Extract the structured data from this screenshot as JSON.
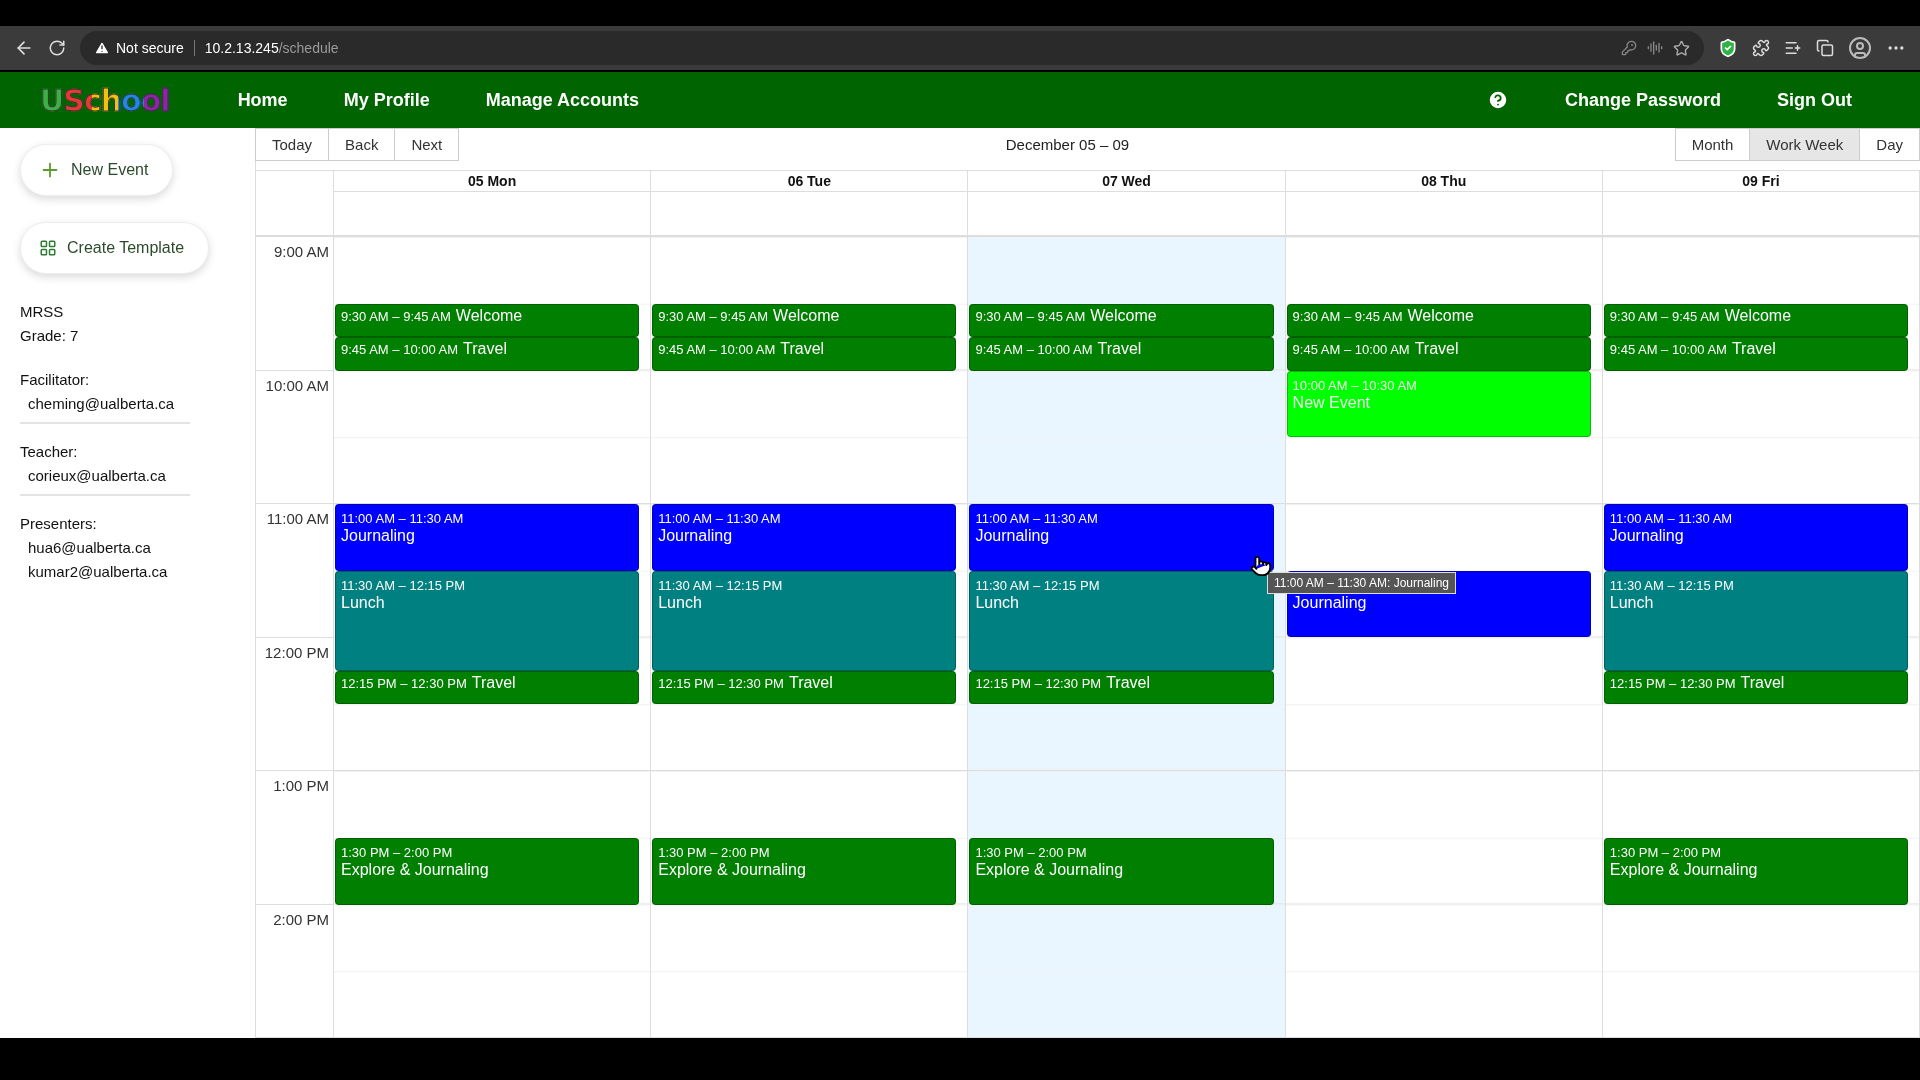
{
  "browser": {
    "security": "Not secure",
    "url_host": "10.2.13.245",
    "url_path": "/schedule"
  },
  "nav": {
    "logo": "USchool",
    "links": [
      "Home",
      "My Profile",
      "Manage Accounts"
    ],
    "right_links": [
      "Change Password",
      "Sign Out"
    ]
  },
  "sidebar": {
    "buttons": [
      "New Event",
      "Create Template"
    ],
    "school": "MRSS",
    "grade": "Grade: 7",
    "contacts": [
      {
        "role": "Facilitator:",
        "emails": [
          "cheming@ualberta.ca"
        ]
      },
      {
        "role": "Teacher:",
        "emails": [
          "corieux@ualberta.ca"
        ]
      },
      {
        "role": "Presenters:",
        "emails": [
          "hua6@ualberta.ca",
          "kumar2@ualberta.ca"
        ]
      }
    ]
  },
  "toolbar": {
    "nav_buttons": [
      "Today",
      "Back",
      "Next"
    ],
    "range": "December 05 – 09",
    "views": [
      {
        "label": "Month",
        "selected": false
      },
      {
        "label": "Work Week",
        "selected": true
      },
      {
        "label": "Day",
        "selected": false
      }
    ]
  },
  "time_labels": [
    "9:00 AM",
    "10:00 AM",
    "11:00 AM",
    "12:00 PM",
    "1:00 PM",
    "2:00 PM"
  ],
  "days": [
    {
      "label": "05 Mon",
      "today": false,
      "events": [
        {
          "time": "9:30 AM – 9:45 AM",
          "title": "Welcome",
          "color": "#007f00"
        },
        {
          "time": "9:45 AM – 10:00 AM",
          "title": "Travel",
          "color": "#007f00"
        },
        {
          "time": "11:00 AM – 11:30 AM",
          "title": "Journaling",
          "color": "#0000ff"
        },
        {
          "time": "11:30 AM – 12:15 PM",
          "title": "Lunch",
          "color": "#008080"
        },
        {
          "time": "12:15 PM – 12:30 PM",
          "title": "Travel",
          "color": "#007f00"
        },
        {
          "time": "1:30 PM – 2:00 PM",
          "title": "Explore & Journaling",
          "color": "#007f00"
        }
      ]
    },
    {
      "label": "06 Tue",
      "today": false,
      "events": [
        {
          "time": "9:30 AM – 9:45 AM",
          "title": "Welcome",
          "color": "#007f00"
        },
        {
          "time": "9:45 AM – 10:00 AM",
          "title": "Travel",
          "color": "#007f00"
        },
        {
          "time": "11:00 AM – 11:30 AM",
          "title": "Journaling",
          "color": "#0000ff"
        },
        {
          "time": "11:30 AM – 12:15 PM",
          "title": "Lunch",
          "color": "#008080"
        },
        {
          "time": "12:15 PM – 12:30 PM",
          "title": "Travel",
          "color": "#007f00"
        },
        {
          "time": "1:30 PM – 2:00 PM",
          "title": "Explore & Journaling",
          "color": "#007f00"
        }
      ]
    },
    {
      "label": "07 Wed",
      "today": true,
      "events": [
        {
          "time": "9:30 AM – 9:45 AM",
          "title": "Welcome",
          "color": "#007f00"
        },
        {
          "time": "9:45 AM – 10:00 AM",
          "title": "Travel",
          "color": "#007f00"
        },
        {
          "time": "11:00 AM – 11:30 AM",
          "title": "Journaling",
          "color": "#0000ff"
        },
        {
          "time": "11:30 AM – 12:15 PM",
          "title": "Lunch",
          "color": "#008080"
        },
        {
          "time": "12:15 PM – 12:30 PM",
          "title": "Travel",
          "color": "#007f00"
        },
        {
          "time": "1:30 PM – 2:00 PM",
          "title": "Explore & Journaling",
          "color": "#007f00"
        }
      ]
    },
    {
      "label": "08 Thu",
      "today": false,
      "events": [
        {
          "time": "9:30 AM – 9:45 AM",
          "title": "Welcome",
          "color": "#007f00"
        },
        {
          "time": "9:45 AM – 10:00 AM",
          "title": "Travel",
          "color": "#007f00"
        },
        {
          "time": "10:00 AM – 10:30 AM",
          "title": "New Event",
          "color": "#00ff00"
        }
      ]
    },
    {
      "label": "09 Fri",
      "today": false,
      "events": [
        {
          "time": "9:30 AM – 9:45 AM",
          "title": "Welcome",
          "color": "#007f00"
        },
        {
          "time": "9:45 AM – 10:00 AM",
          "title": "Travel",
          "color": "#007f00"
        },
        {
          "time": "11:00 AM – 11:30 AM",
          "title": "Journaling",
          "color": "#0000ff"
        },
        {
          "time": "11:30 AM – 12:15 PM",
          "title": "Lunch",
          "color": "#008080"
        },
        {
          "time": "12:15 PM – 12:30 PM",
          "title": "Travel",
          "color": "#007f00"
        },
        {
          "time": "1:30 PM – 2:00 PM",
          "title": "Explore & Journaling",
          "color": "#007f00"
        }
      ]
    }
  ],
  "drag_preview": {
    "title": "Journaling",
    "color": "#0000ff"
  },
  "tooltip": "11:00 AM – 11:30 AM: Journaling"
}
